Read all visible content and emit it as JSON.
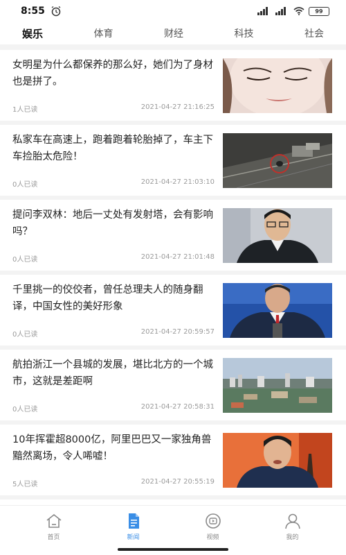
{
  "status_bar": {
    "time": "8:55",
    "battery": "99"
  },
  "tabs": [
    {
      "label": "娱乐",
      "active": true
    },
    {
      "label": "体育",
      "active": false
    },
    {
      "label": "财经",
      "active": false
    },
    {
      "label": "科技",
      "active": false
    },
    {
      "label": "社会",
      "active": false
    }
  ],
  "news": [
    {
      "title": "女明星为什么都保养的那么好，她们为了身材也是拼了。",
      "reads": "1人已读",
      "time": "2021-04-27 21:16:25",
      "thumb": "woman-face"
    },
    {
      "title": "私家车在高速上，跑着跑着轮胎掉了，车主下车捡胎太危险！",
      "reads": "0人已读",
      "time": "2021-04-27 21:03:10",
      "thumb": "highway"
    },
    {
      "title": "提问李双林：地后一丈处有发射塔，会有影响吗？",
      "reads": "0人已读",
      "time": "2021-04-27 21:01:48",
      "thumb": "man-glasses"
    },
    {
      "title": "千里挑一的佼佼者，曾任总理夫人的随身翻译，中国女性的美好形象",
      "reads": "0人已读",
      "time": "2021-04-27 20:59:57",
      "thumb": "man-suit"
    },
    {
      "title": "航拍浙江一个县城的发展，堪比北方的一个城市，这就是差距啊",
      "reads": "0人已读",
      "time": "2021-04-27 20:58:31",
      "thumb": "city-aerial"
    },
    {
      "title": "10年挥霍超8000亿，阿里巴巴又一家独角兽黯然离场，令人唏嘘！",
      "reads": "5人已读",
      "time": "2021-04-27 20:55:19",
      "thumb": "man-orange"
    }
  ],
  "bottom_nav": [
    {
      "label": "首页",
      "icon": "home-icon",
      "active": false
    },
    {
      "label": "新闻",
      "icon": "news-icon",
      "active": true
    },
    {
      "label": "视频",
      "icon": "video-icon",
      "active": false
    },
    {
      "label": "我的",
      "icon": "user-icon",
      "active": false
    }
  ],
  "colors": {
    "accent": "#3a8ee6",
    "meta_text": "#9a9a9a"
  }
}
